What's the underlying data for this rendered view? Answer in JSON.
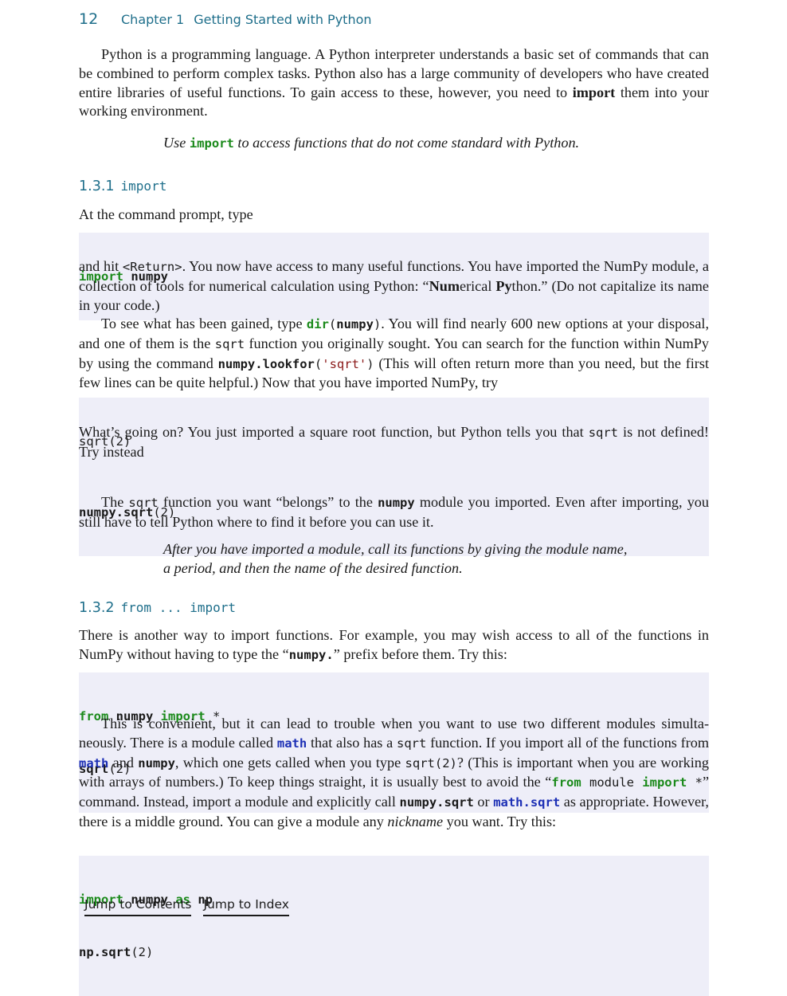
{
  "header": {
    "page_number": "12",
    "chapter_label": "Chapter 1",
    "chapter_title": "Getting Started with Python"
  },
  "intro": {
    "p1_a": "Python is a programming language. A Python interpreter understands a basic set of commands that can be combined to perform complex tasks. Python also has a large community of developers who have created entire libraries of useful functions. To gain access to these, however, you need to ",
    "p1_bold": "import",
    "p1_b": " them into your working environment.",
    "callout_a": "Use ",
    "callout_code": "import",
    "callout_b": " to access functions that do not come standard with Python."
  },
  "section_1": {
    "number": "1.3.1",
    "title_code": "import",
    "prompt_text": "At the command prompt, type",
    "code1": {
      "kw": "import",
      "rest": " numpy"
    },
    "p2_a": "and hit ",
    "p2_code": "<Return>",
    "p2_b": ". You now have access to many useful functions. You have imported the NumPy module, a collection of tools for numerical calculation using Python: “",
    "p2_num": "Num",
    "p2_erical": "erical ",
    "p2_py": "Py",
    "p2_c": "thon.” (Do not capitalize its name in your code.)",
    "p3_a": "To see what has been gained, type ",
    "p3_dir": "dir",
    "p3_paren_open": "(",
    "p3_numpy": "numpy",
    "p3_paren_close": ")",
    "p3_b": ". You will find nearly 600 new options at your disposal, and one of them is the ",
    "p3_sqrt": "sqrt",
    "p3_c": " function you originally sought. You can search for the function within NumPy by using the command ",
    "p3_lookfor": "numpy.lookfor",
    "p3_lp": "(",
    "p3_str": "'sqrt'",
    "p3_rp": ")",
    "p3_d": " (This will often return more than you need, but the first few lines can be quite helpful.) Now that you have imported NumPy, try",
    "code2": "sqrt(2)",
    "p4_a": "What’s going on? You just imported a square root function, but Python tells you that ",
    "p4_sqrt": "sqrt",
    "p4_b": " is not defined! Try instead",
    "code3": {
      "bold": "numpy.sqrt",
      "rest": "(2)"
    },
    "p5_a": "The ",
    "p5_sqrt": "sqrt",
    "p5_b": " function you want “belongs” to the ",
    "p5_numpy": "numpy",
    "p5_c": " module you imported. Even after importing, you still have to tell Python where to find it before you can use it.",
    "callout": "After you have imported a module, call its functions by giving the module name, a period, and then the name of the desired function."
  },
  "section_2": {
    "number": "1.3.2",
    "title_code": "from ... import",
    "p1_a": "There is another way to import functions. For example, you may wish access to all of the functions in NumPy without having to type the “",
    "p1_code": "numpy.",
    "p1_b": "” prefix before them. Try this:",
    "code1_line1": {
      "kw1": "from",
      "mid": " numpy ",
      "kw2": "import",
      "rest": " *"
    },
    "code1_line2": {
      "bold": "sqrt",
      "rest": "(2)"
    },
    "p2_a": "This is convenient, but it can lead to trouble when you want to use two different modules simulta­neously. There is a module called ",
    "p2_math": "math",
    "p2_b": " that also has a ",
    "p2_sqrt": "sqrt",
    "p2_c": " function. If you import all of the func­tions from ",
    "p2_math2": "math",
    "p2_d": " and ",
    "p2_numpy": "numpy",
    "p2_e": ", which one gets called when you type ",
    "p2_sqrt2": "sqrt(2)",
    "p2_f": "? (This is important when you are working with arrays of numbers.) To keep things straight, it is usually best to avoid the “",
    "p2_from": "from",
    "p2_module": " module ",
    "p2_import": "import",
    "p2_star": " *",
    "p2_g": "” command. Instead, import a module and explicitly call ",
    "p2_npsqrt": "numpy.sqrt",
    "p2_h": " or ",
    "p2_mathsqrt": "math.sqrt",
    "p2_i": " as appropriate. However, there is a middle ground. You can give a module any ",
    "p2_nick": "nickname",
    "p2_j": " you want. Try this:",
    "code2_line1": {
      "kw1": "import",
      "mid": " numpy ",
      "kw2": "as",
      "rest": " np"
    },
    "code2_line2": {
      "bold": "np.sqrt",
      "rest": "(2)"
    }
  },
  "footer": {
    "contents_link": "Jump to Contents",
    "index_link": "Jump to Index"
  },
  "colors": {
    "heading_teal": "#1f6f8b",
    "keyword_green": "#1b8a1b",
    "builtin_blue": "#1c2fb5",
    "string_red": "#8b1a1a",
    "code_bg": "#eeeef8"
  }
}
